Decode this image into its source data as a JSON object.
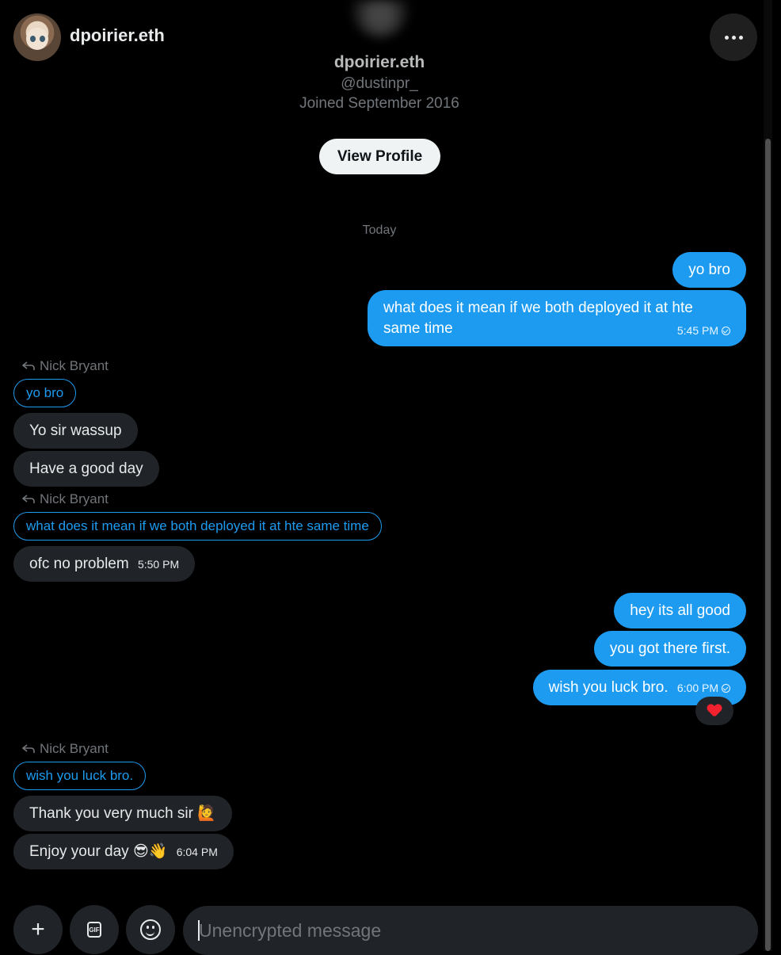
{
  "header": {
    "name": "dpoirier.eth",
    "more_icon": "more-horizontal-icon"
  },
  "profile": {
    "name": "dpoirier.eth",
    "handle": "@dustinpr_",
    "joined": "Joined September 2016",
    "view_profile_label": "View Profile"
  },
  "day_separator": "Today",
  "messages": {
    "m1": {
      "text": "yo bro"
    },
    "m2": {
      "line1": "what does it mean if we both deployed it at hte",
      "line2": "same time",
      "time": "5:45 PM"
    },
    "r1": {
      "reply_to": "Nick Bryant",
      "quote": "yo bro"
    },
    "m3": {
      "text": "Yo sir wassup"
    },
    "m4": {
      "text": "Have a good day"
    },
    "r2": {
      "reply_to": "Nick Bryant",
      "quote": "what does it mean if we both deployed it at hte same time"
    },
    "m5": {
      "text": "ofc no problem",
      "time": "5:50 PM"
    },
    "m6": {
      "text": "hey its all good"
    },
    "m7": {
      "text": "you got there first."
    },
    "m8": {
      "text": "wish you luck bro.",
      "time": "6:00 PM",
      "reaction": "❤️"
    },
    "r3": {
      "reply_to": "Nick Bryant",
      "quote": "wish you luck bro."
    },
    "m9": {
      "text": "Thank you very much sir 🙋"
    },
    "m10": {
      "text": "Enjoy your day 😎👋",
      "time": "6:04 PM"
    }
  },
  "composer": {
    "placeholder": "Unencrypted message",
    "add_icon": "plus-icon",
    "gif_icon": "gif-icon",
    "gif_label": "GIF",
    "emoji_icon": "emoji-icon"
  },
  "colors": {
    "background": "#000000",
    "sent_bubble": "#1d9bf0",
    "received_bubble": "#202327",
    "muted_text": "#71767b"
  }
}
